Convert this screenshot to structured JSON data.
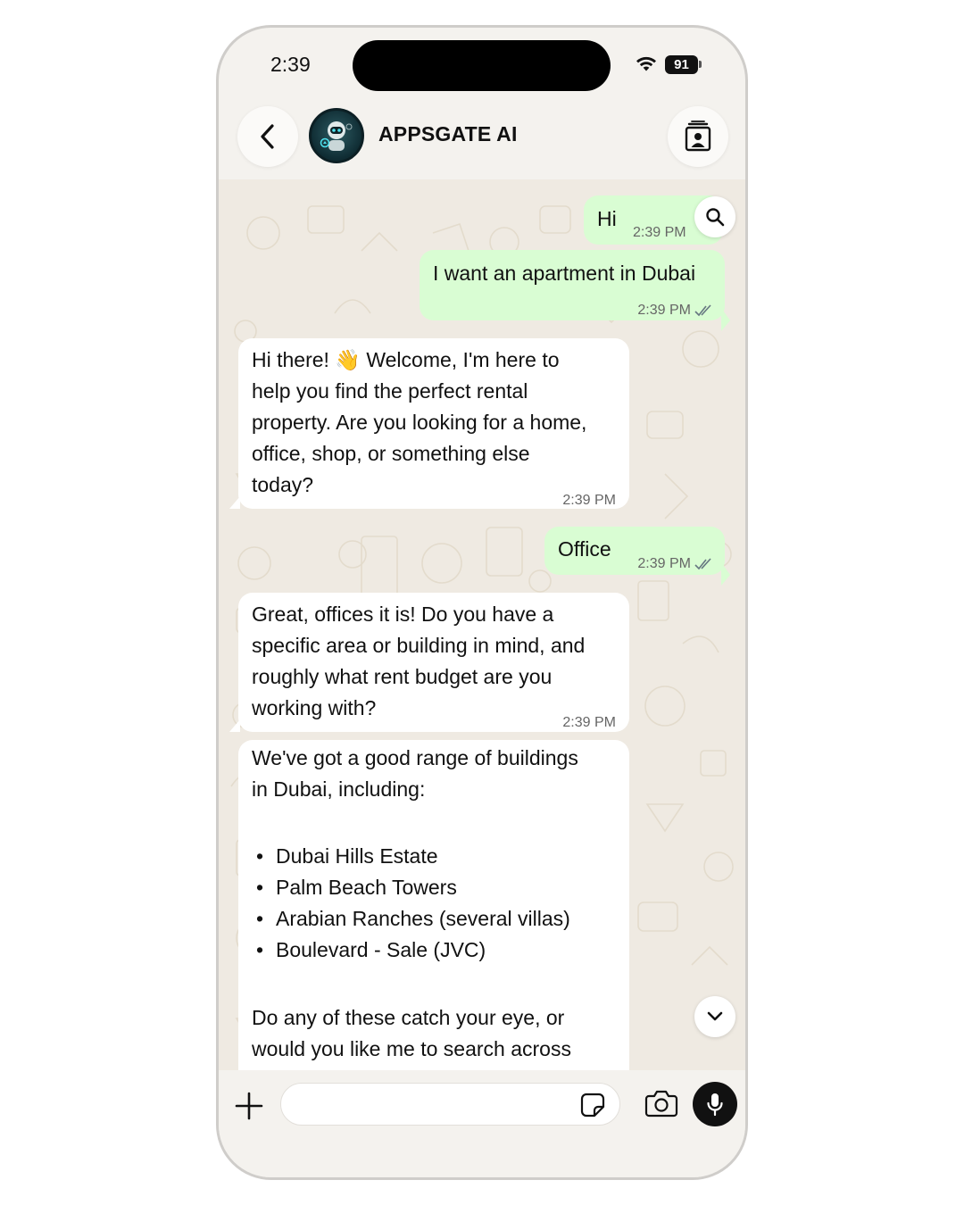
{
  "status_bar": {
    "time": "2:39",
    "battery": "91",
    "icons": [
      "wifi-icon",
      "battery-icon"
    ]
  },
  "header": {
    "contact_name": "APPSGATE AI",
    "back_icon": "chevron-left-icon",
    "avatar_icon": "robot-avatar",
    "contact_card_icon": "contact-card-icon"
  },
  "messages": [
    {
      "direction": "out",
      "text": "Hi",
      "time": "2:39 PM",
      "status": "read"
    },
    {
      "direction": "out",
      "text": "I want an apartment in Dubai",
      "time": "2:39 PM",
      "status": "read"
    },
    {
      "direction": "in",
      "lines": [
        "Hi there! 👋 Welcome, I'm here to",
        "help you find the perfect rental",
        "property. Are you looking for a home,",
        "office, shop, or something else",
        "today?"
      ],
      "time": "2:39 PM"
    },
    {
      "direction": "out",
      "text": "Office",
      "time": "2:39 PM",
      "status": "read"
    },
    {
      "direction": "in",
      "lines": [
        "Great, offices it is! Do you have a",
        "specific area or building in mind, and",
        "roughly what rent budget are you",
        "working with?"
      ],
      "time": "2:39 PM"
    },
    {
      "direction": "in",
      "intro": [
        "We've got a good range of buildings",
        "in Dubai, including:"
      ],
      "items": [
        "Dubai Hills Estate",
        "Palm Beach Towers",
        "Arabian Ranches (several villas)",
        "Boulevard - Sale (JVC)"
      ],
      "outro": [
        "Do any of these catch your eye, or",
        "would you like me to search across"
      ]
    }
  ],
  "floating_buttons": {
    "search_icon": "search-icon",
    "scroll_down_icon": "chevron-down-icon"
  },
  "composer": {
    "placeholder": "",
    "plus_icon": "plus-icon",
    "sticker_icon": "sticker-icon",
    "camera_icon": "camera-icon",
    "mic_icon": "mic-icon"
  },
  "colors": {
    "outgoing_bubble": "#d9fdd3",
    "incoming_bubble": "#ffffff",
    "chat_background": "#efeae2",
    "tick_color": "#667781"
  }
}
